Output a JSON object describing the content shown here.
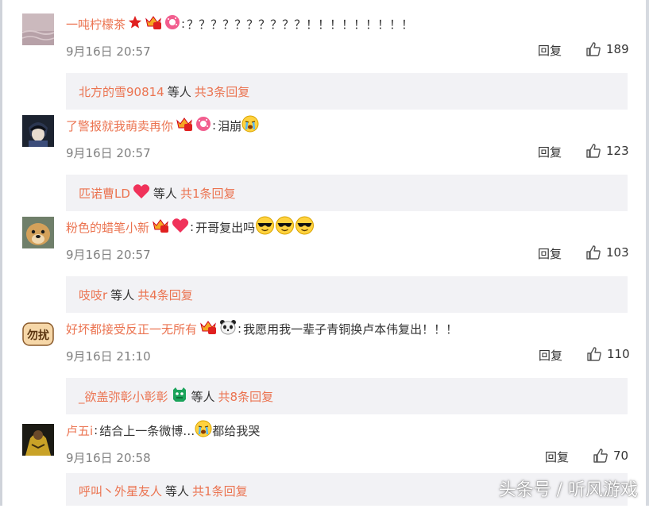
{
  "colors": {
    "username": "#eb7350",
    "meta": "#808080",
    "reply_box": "#f2f2f5",
    "text": "#333333"
  },
  "comments": [
    {
      "username": "一吨柠檬茶",
      "badges": [
        "star-badge-icon",
        "vip-crown-icon",
        "donut-badge-icon"
      ],
      "separator": ":",
      "text": "？？？？？？？？？？！！！！！！！！！",
      "emojis": [],
      "time": "9月16日 20:57",
      "reply_label": "回复",
      "like_count": "189",
      "sub_user": "北方的雪90814",
      "sub_user_badge": "",
      "sub_middle": "等人",
      "sub_total": "共3条回复"
    },
    {
      "username": "了警报就我萌卖再你",
      "badges": [
        "vip-crown-icon",
        "donut-badge-icon"
      ],
      "separator": ":",
      "text": "泪崩",
      "emojis": [
        "crying-emoji-icon"
      ],
      "time": "9月16日 20:57",
      "reply_label": "回复",
      "like_count": "123",
      "sub_user": "匹诺曹LD",
      "sub_user_badge": "heart-icon",
      "sub_middle": "等人",
      "sub_total": "共1条回复"
    },
    {
      "username": "粉色的蜡笔小新",
      "badges": [
        "vip-crown-icon",
        "heart-icon"
      ],
      "separator": ":",
      "text": "开哥复出吗",
      "emojis": [
        "sunglasses-emoji-icon",
        "sunglasses-emoji-icon",
        "sunglasses-emoji-icon"
      ],
      "time": "9月16日 20:57",
      "reply_label": "回复",
      "like_count": "103",
      "sub_user": "吱吱r",
      "sub_user_badge": "",
      "sub_middle": "等人",
      "sub_total": "共4条回复"
    },
    {
      "username": "好坏都接受反正一无所有",
      "badges": [
        "vip-crown-icon",
        "panda-badge-icon"
      ],
      "separator": ":",
      "text": "我愿用我一辈子青铜换卢本伟复出！！！",
      "emojis": [],
      "time": "9月16日 21:10",
      "reply_label": "回复",
      "like_count": "110",
      "sub_user": "_欲盖弥彰小彰彰",
      "sub_user_badge": "green-monster-icon",
      "sub_middle": "等人",
      "sub_total": "共8条回复"
    },
    {
      "username": "卢五i",
      "badges": [],
      "separator": ":",
      "text": "结合上一条微博…",
      "emojis": [
        "crying-emoji-icon"
      ],
      "text_after": "都给我哭",
      "time": "9月16日 20:58",
      "reply_label": "回复",
      "like_count": "70",
      "sub_user": "呼叫丶外星友人",
      "sub_user_badge": "",
      "sub_middle": "等人",
      "sub_total": "共1条回复"
    }
  ],
  "avatar_texts": {
    "comment_4": "勿扰"
  },
  "watermark": "头条号 / 听风游戏"
}
